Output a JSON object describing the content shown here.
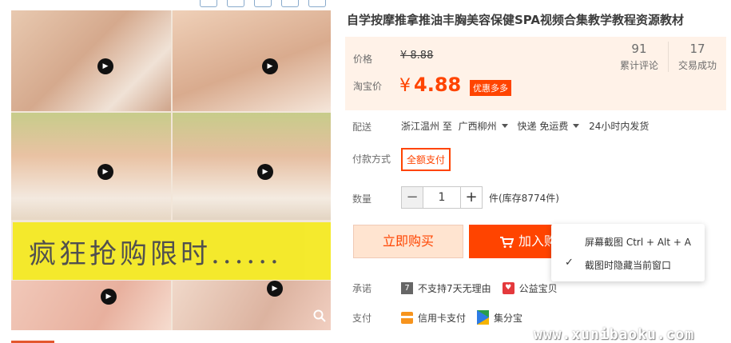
{
  "gallery": {
    "banner_text": "疯狂抢购限时......",
    "play_icon": "play-icon",
    "zoom_icon": "zoom-icon"
  },
  "product": {
    "title": "自学按摩推拿推油丰胸美容保健SPA视频合集教学教程资源教材"
  },
  "price": {
    "label": "价格",
    "original": "¥ 8.88",
    "taobao_label": "淘宝价",
    "currency": "¥",
    "current": "4.88",
    "promo_badge": "优惠多多",
    "stats": [
      {
        "number": "91",
        "label": "累计评论"
      },
      {
        "number": "17",
        "label": "交易成功"
      }
    ]
  },
  "shipping": {
    "label": "配送",
    "from": "浙江温州 至",
    "to": "广西柳州",
    "method": "快递 免运费",
    "time": "24小时内发货"
  },
  "payment_method": {
    "label": "付款方式",
    "option": "全额支付"
  },
  "quantity": {
    "label": "数量",
    "minus": "−",
    "value": "1",
    "plus": "+",
    "stock": "件(库存8774件)"
  },
  "actions": {
    "buy_now": "立即购买",
    "add_to_cart": "加入购物车"
  },
  "context_menu": {
    "item_screenshot": "屏幕截图 Ctrl + Alt + A",
    "item_hide_window": "截图时隐藏当前窗口",
    "check": "✓"
  },
  "promise": {
    "label": "承诺",
    "no_return": "不支持7天无理由",
    "charity": "公益宝贝"
  },
  "pay": {
    "label": "支付",
    "credit_card": "信用卡支付",
    "jifenbao": "集分宝"
  },
  "watermark": "www.xunibaoku.com",
  "colors": {
    "accent": "#ff4400",
    "price_bg": "#fff2e8",
    "banner": "#f5ea1e"
  }
}
